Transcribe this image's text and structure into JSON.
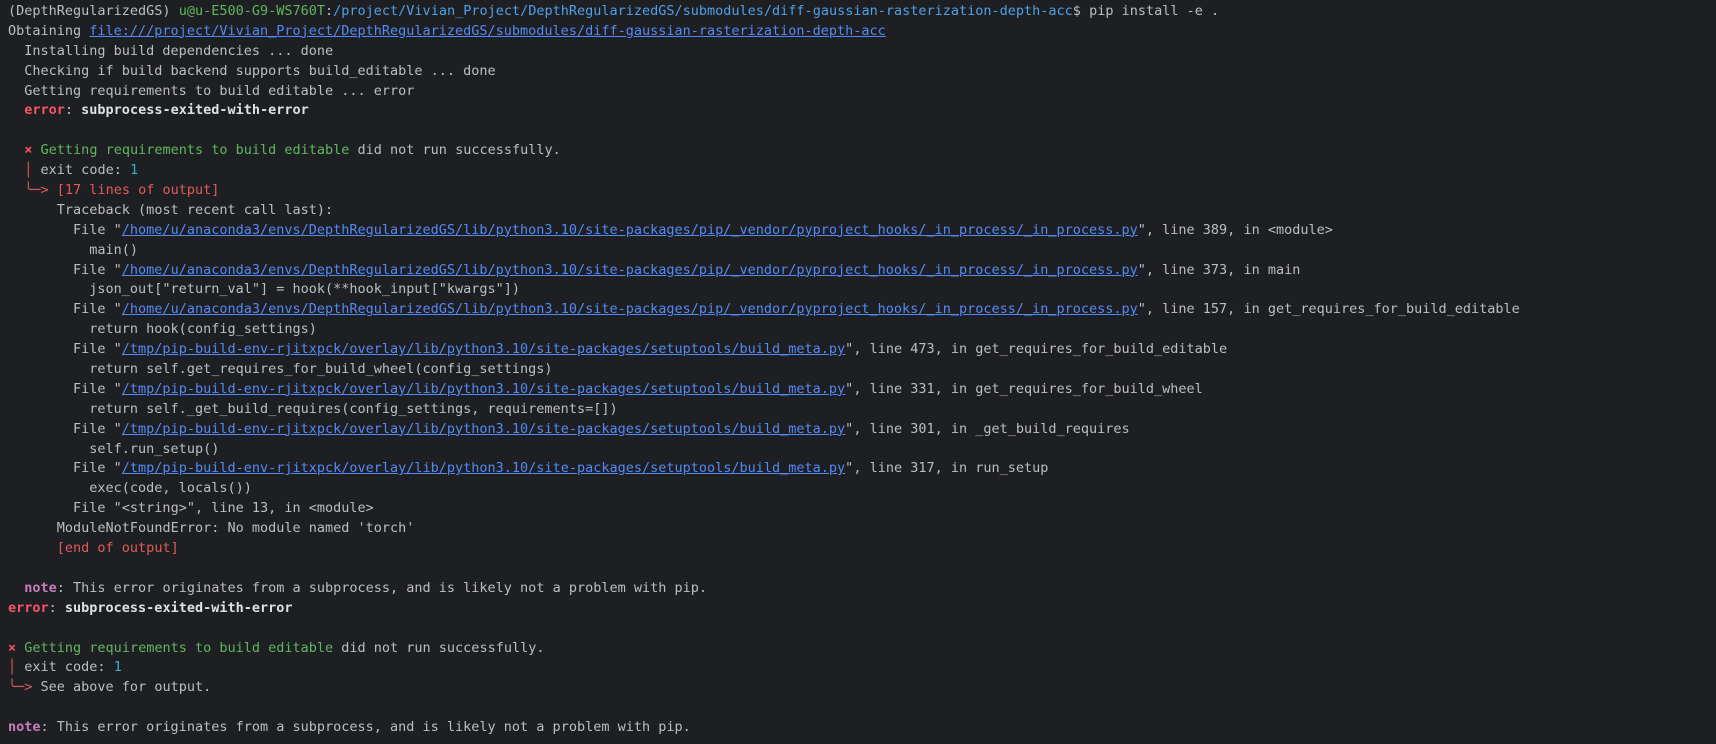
{
  "prompt": {
    "env": "(DepthRegularizedGS)",
    "user_host": "u@u-E500-G9-WS760T",
    "cwd": "/project/Vivian_Project/DepthRegularizedGS/submodules/diff-gaussian-rasterization-depth-acc",
    "symbol": "$",
    "command": "pip install -e ."
  },
  "obtaining": {
    "label": "Obtaining ",
    "url": "file:///project/Vivian_Project/DepthRegularizedGS/submodules/diff-gaussian-rasterization-depth-acc"
  },
  "steps": [
    "  Installing build dependencies ... done",
    "  Checking if build backend supports build_editable ... done",
    "  Getting requirements to build editable ... error"
  ],
  "error1": {
    "label": "error",
    "message": "subprocess-exited-with-error"
  },
  "block1": {
    "x": "×",
    "title": "Getting requirements to build editable",
    "rest": " did not run successfully.",
    "exit_label": "exit code: ",
    "exit_code": "1",
    "output_marker": "[17 lines of output]",
    "end_marker": "[end of output]"
  },
  "traceback": {
    "header": "Traceback (most recent call last):",
    "frames": [
      {
        "path": "/home/u/anaconda3/envs/DepthRegularizedGS/lib/python3.10/site-packages/pip/_vendor/pyproject_hooks/_in_process/_in_process.py",
        "where": ", line 389, in <module>",
        "code": "main()"
      },
      {
        "path": "/home/u/anaconda3/envs/DepthRegularizedGS/lib/python3.10/site-packages/pip/_vendor/pyproject_hooks/_in_process/_in_process.py",
        "where": ", line 373, in main",
        "code": "json_out[\"return_val\"] = hook(**hook_input[\"kwargs\"])"
      },
      {
        "path": "/home/u/anaconda3/envs/DepthRegularizedGS/lib/python3.10/site-packages/pip/_vendor/pyproject_hooks/_in_process/_in_process.py",
        "where": ", line 157, in get_requires_for_build_editable",
        "code": "return hook(config_settings)"
      },
      {
        "path": "/tmp/pip-build-env-rjitxpck/overlay/lib/python3.10/site-packages/setuptools/build_meta.py",
        "where": ", line 473, in get_requires_for_build_editable",
        "code": "return self.get_requires_for_build_wheel(config_settings)"
      },
      {
        "path": "/tmp/pip-build-env-rjitxpck/overlay/lib/python3.10/site-packages/setuptools/build_meta.py",
        "where": ", line 331, in get_requires_for_build_wheel",
        "code": "return self._get_build_requires(config_settings, requirements=[])"
      },
      {
        "path": "/tmp/pip-build-env-rjitxpck/overlay/lib/python3.10/site-packages/setuptools/build_meta.py",
        "where": ", line 301, in _get_build_requires",
        "code": "self.run_setup()"
      },
      {
        "path": "/tmp/pip-build-env-rjitxpck/overlay/lib/python3.10/site-packages/setuptools/build_meta.py",
        "where": ", line 317, in run_setup",
        "code": "exec(code, locals())"
      }
    ],
    "last_frame": "File \"<string>\", line 13, in <module>",
    "exception": "ModuleNotFoundError: No module named 'torch'"
  },
  "note1": {
    "label": "note",
    "message": ": This error originates from a subprocess, and is likely not a problem with pip."
  },
  "error2": {
    "label": "error",
    "message": "subprocess-exited-with-error"
  },
  "block2": {
    "x": "×",
    "title": "Getting requirements to build editable",
    "rest": " did not run successfully.",
    "exit_label": "exit code: ",
    "exit_code": "1",
    "see_above": "See above for output."
  },
  "note2": {
    "label": "note",
    "message": ": This error originates from a subprocess, and is likely not a problem with pip."
  },
  "colors": {
    "background": "#1e1f22",
    "text": "#bcbec4",
    "error": "#f75464",
    "success": "#5fb85f",
    "link": "#548af7",
    "note": "#c77dbb",
    "exit_code": "#2fb5c8"
  },
  "icons": {
    "tree_branch": "tree-branch-icon",
    "tree_arrow": "tree-arrow-icon"
  }
}
